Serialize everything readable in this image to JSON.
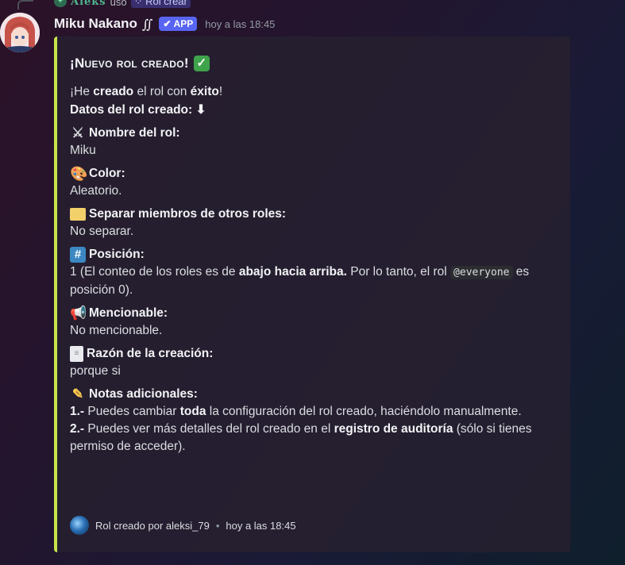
{
  "reply": {
    "user": "Aleks",
    "verb": "usó",
    "command": "Rol crear",
    "command_icon": "slash-command-icon"
  },
  "message": {
    "username": "Miku Nakano",
    "username_suffix": "∬",
    "badge": "APP",
    "timestamp": "hoy a las 18:45"
  },
  "embed": {
    "accent_color": "#c8e44a",
    "title": "¡Nuevo rol creado!",
    "title_icon": "check-mark-icon",
    "desc": {
      "line1_a": "¡He ",
      "line1_b": "creado",
      "line1_c": " el rol con ",
      "line1_d": "éxito",
      "line1_e": "!",
      "line2": "Datos del rol creado: ⬇"
    },
    "fields": {
      "name": {
        "label": "Nombre del rol:",
        "icon": "crossed-swords-icon",
        "value": "Miku"
      },
      "color": {
        "label": "Color:",
        "icon": "palette-icon",
        "value": "Aleatorio."
      },
      "separate": {
        "label": "Separar miembros de otros roles:",
        "icon": "folder-icon",
        "value": "No separar."
      },
      "position": {
        "label": "Posición:",
        "icon": "hash-icon",
        "value_a": "1 (El conteo de los roles es de ",
        "value_b": "abajo hacia arriba.",
        "value_c": " Por lo tanto, el rol ",
        "value_code": "@everyone",
        "value_d": " es posición 0)."
      },
      "mentionable": {
        "label": "Mencionable:",
        "icon": "megaphone-icon",
        "value": "No mencionable."
      },
      "reason": {
        "label": "Razón de la creación:",
        "icon": "page-icon",
        "value": "porque si"
      },
      "notes": {
        "label": "Notas adicionales:",
        "icon": "memo-icon",
        "n1_num": "1.-",
        "n1_a": " Puedes cambiar ",
        "n1_b": "toda",
        "n1_c": " la configuración del rol creado, haciéndolo manualmente.",
        "n2_num": "2.-",
        "n2_a": " Puedes ver más detalles del rol creado en el ",
        "n2_b": "registro de auditoría",
        "n2_c": " (sólo si tienes permiso de acceder)."
      }
    },
    "footer": {
      "text": "Rol creado por aleksi_79",
      "separator": "•",
      "timestamp": "hoy a las 18:45"
    }
  }
}
